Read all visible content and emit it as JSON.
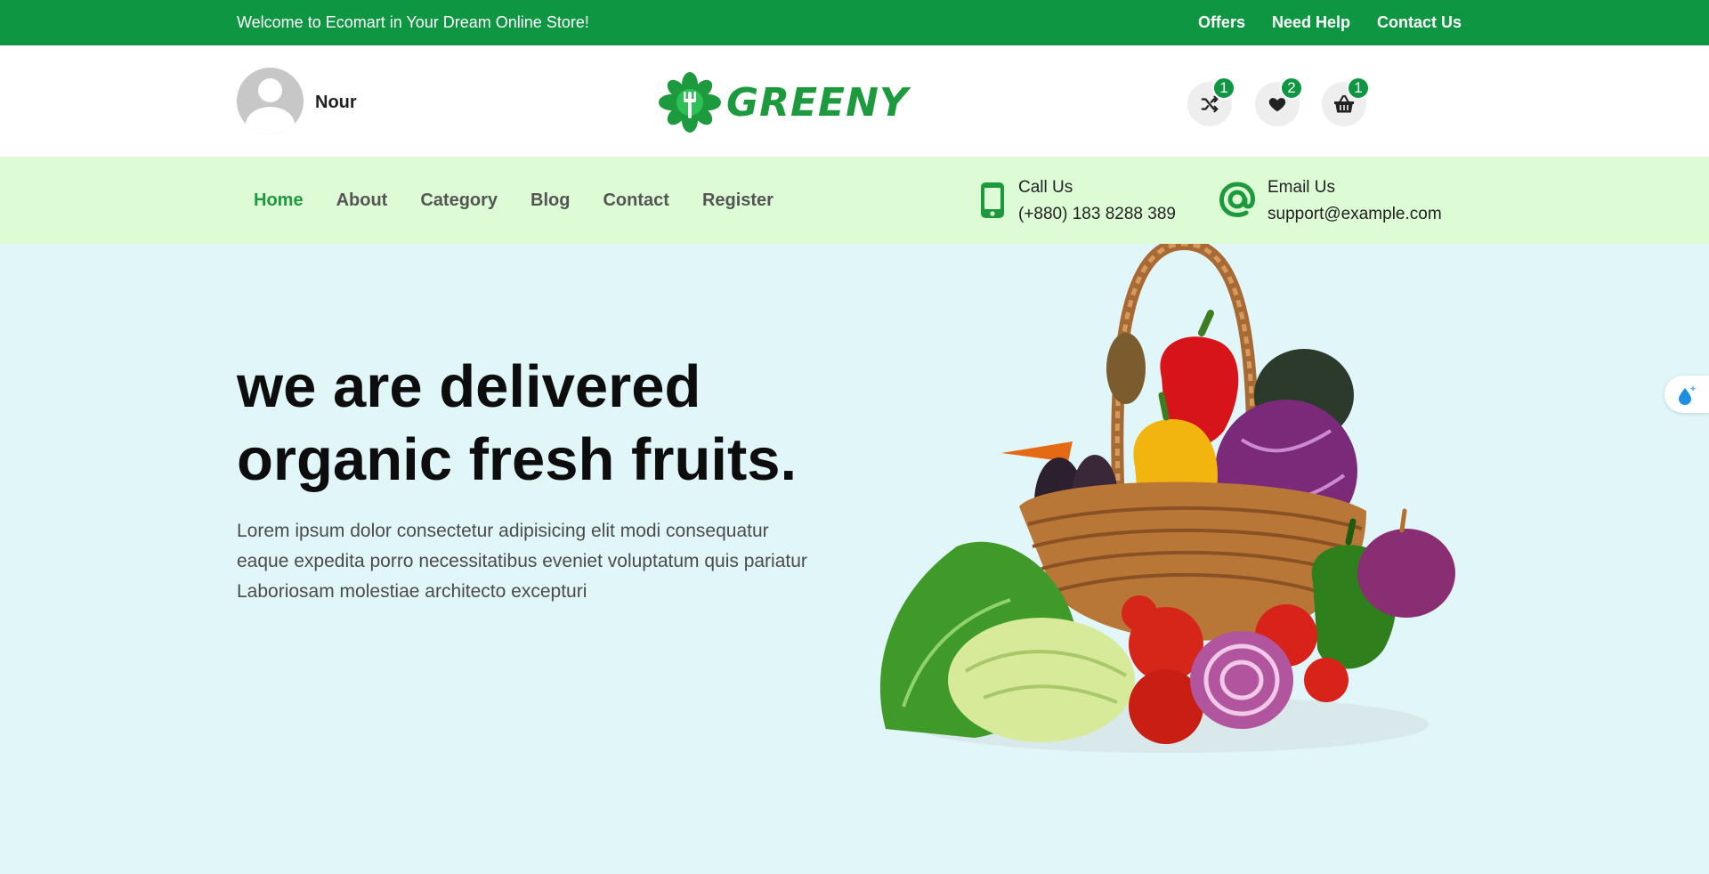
{
  "topbar": {
    "welcome": "Welcome to Ecomart in Your Dream Online Store!",
    "links": [
      "Offers",
      "Need Help",
      "Contact Us"
    ]
  },
  "header": {
    "username": "Nour",
    "logo_text": "GREENY",
    "badges": {
      "compare": "1",
      "wishlist": "2",
      "cart": "1"
    }
  },
  "nav": {
    "items": [
      "Home",
      "About",
      "Category",
      "Blog",
      "Contact",
      "Register"
    ],
    "active": "Home"
  },
  "contact": {
    "call_label": "Call Us",
    "call_value": "(+880) 183 8288 389",
    "email_label": "Email Us",
    "email_value": "support@example.com"
  },
  "hero": {
    "title_line1": "we are delivered",
    "title_line2": "organic fresh fruits.",
    "text": "Lorem ipsum dolor consectetur adipisicing elit modi consequatur eaque expedita porro necessitatibus eveniet voluptatum quis pariatur Laboriosam molestiae architecto excepturi"
  },
  "colors": {
    "brand_green": "#0f9642",
    "nav_bg": "#ddfcd6",
    "hero_bg": "#e1f6f9"
  }
}
